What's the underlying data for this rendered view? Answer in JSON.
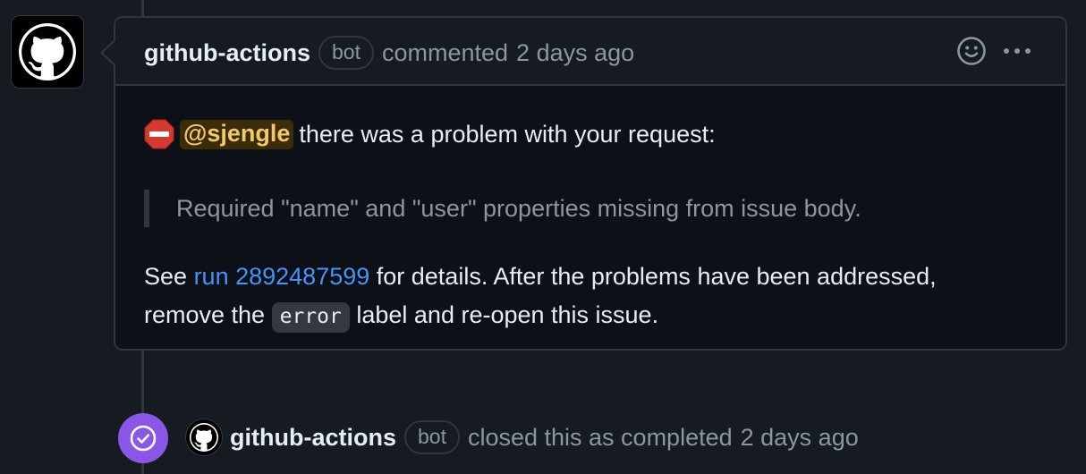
{
  "comment": {
    "author": "github-actions",
    "badge": "bot",
    "action": "commented",
    "timestamp": "2 days ago",
    "icons": [
      "github-octocat-icon",
      "smiley-icon",
      "kebab-menu-icon"
    ],
    "body": {
      "emoji": "stop-sign-icon",
      "mention": "@sjengle",
      "line1_rest": "there was a problem with your request:",
      "quote": "Required \"name\" and \"user\" properties missing from issue body.",
      "see": "See",
      "run_link": "run 2892487599",
      "after_link": "for details. After the problems have been addressed,",
      "remove_the": "remove the",
      "code_label": "error",
      "after_code": "label and re-open this issue."
    }
  },
  "event": {
    "icon": "check-circle-icon",
    "author": "github-actions",
    "badge": "bot",
    "text": "closed this as completed",
    "timestamp": "2 days ago"
  },
  "colors": {
    "background": "#161b22",
    "border": "#30363d",
    "muted_text": "#8d96a0",
    "link": "#4493f8",
    "mention_bg": "#3b2c0a",
    "mention_text": "#f0c96a",
    "closed_purple": "#8957e5"
  }
}
